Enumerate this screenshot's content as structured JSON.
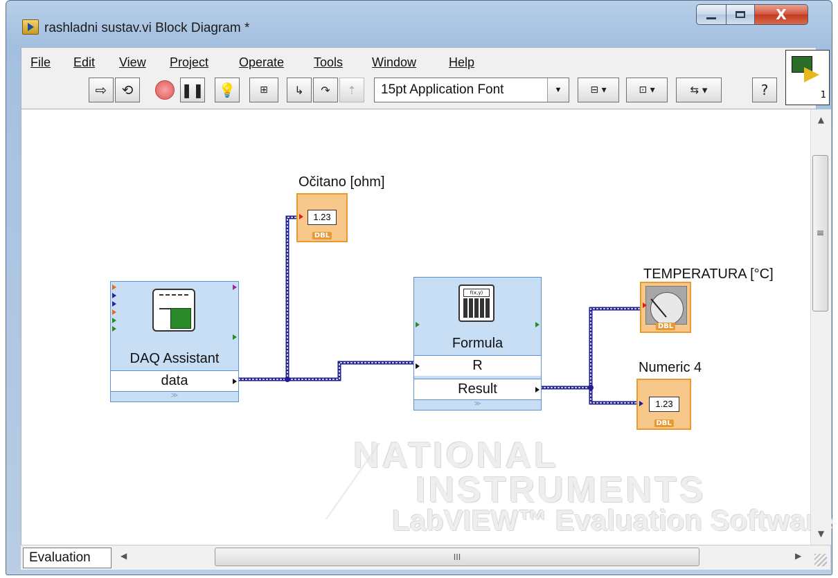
{
  "window": {
    "title": "rashladni sustav.vi Block Diagram *",
    "minimize_icon": "minimize-icon",
    "maximize_icon": "maximize-icon",
    "close_glyph": "X"
  },
  "menu": {
    "items": [
      {
        "label": "File"
      },
      {
        "label": "Edit"
      },
      {
        "label": "View"
      },
      {
        "label": "Project"
      },
      {
        "label": "Operate"
      },
      {
        "label": "Tools"
      },
      {
        "label": "Window"
      },
      {
        "label": "Help"
      }
    ]
  },
  "toolbar": {
    "font_select_value": "15pt Application Font",
    "context_help_glyph": "?",
    "vi_icon_number": "1"
  },
  "diagram": {
    "daq": {
      "title": "DAQ Assistant",
      "output_label": "data"
    },
    "formula": {
      "title": "Formula",
      "input_label": "R",
      "output_label": "Result"
    },
    "indicators": {
      "ocitano": {
        "label": "Očitano [ohm]",
        "value": "1.23",
        "type": "DBL"
      },
      "temperatura": {
        "label": "TEMPERATURA  [°C]",
        "type": "DBL"
      },
      "numeric4": {
        "label": "Numeric 4",
        "value": "1.23",
        "type": "DBL"
      }
    },
    "watermark": {
      "line1": "NATIONAL",
      "line2": "INSTRUMENTS",
      "line3": "LabVIEW™ Evaluation Software"
    },
    "wire_color": "#1f1f8f"
  },
  "statusbar": {
    "tab_label": "Evaluation",
    "hscroll_grip": "III"
  },
  "colors": {
    "express_fill": "#c8def5",
    "express_border": "#5b8fd0",
    "indicator_fill": "#f8c88a",
    "indicator_border": "#e79a34"
  }
}
